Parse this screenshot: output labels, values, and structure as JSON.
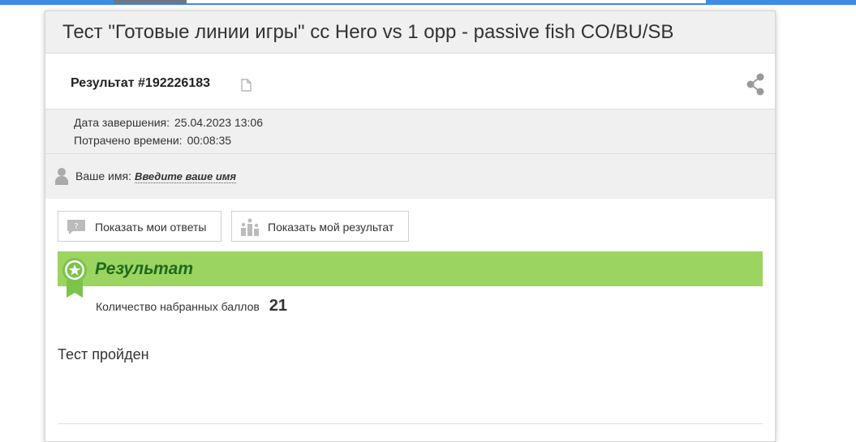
{
  "header": {
    "title": "Тест \"Готовые линии игры\" cc Hero vs 1 opp - passive fish CO/BU/SB"
  },
  "result": {
    "title": "Результат #192226183"
  },
  "meta": {
    "completed_label": "Дата завершения:",
    "completed_value": "25.04.2023 13:06",
    "time_label": "Потрачено времени:",
    "time_value": "00:08:35"
  },
  "user": {
    "name_label": "Ваше имя:",
    "name_placeholder": "Введите ваше имя"
  },
  "buttons": {
    "show_answers": "Показать мои ответы",
    "show_result": "Показать мой результат"
  },
  "banner": {
    "title": "Результат"
  },
  "score": {
    "label": "Количество набранных баллов",
    "value": "21"
  },
  "status": {
    "text": "Тест пройден"
  },
  "colors": {
    "accent_green": "#9cd462",
    "title_green": "#1d6a1d",
    "top_bar": "#3d8be6"
  },
  "icons": [
    "copy-icon",
    "share-icon",
    "person-icon",
    "answers-icon",
    "ranking-icon",
    "award-ribbon-icon"
  ]
}
